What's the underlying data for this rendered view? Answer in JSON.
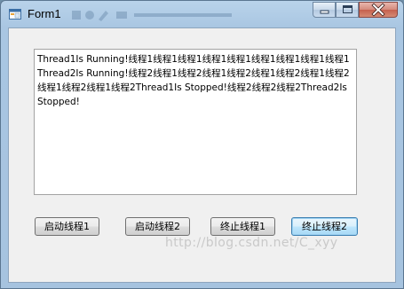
{
  "window": {
    "title": "Form1",
    "watermark": "http://blog.csdn.net/C_xyy"
  },
  "output": {
    "text": "Thread1Is Running!线程1线程1线程1线程1线程1线程1线程1线程1线程1Thread2Is Running!线程2线程1线程2线程1线程2线程1线程2线程1线程2线程1线程2线程1线程2Thread1Is Stopped!线程2线程2线程2Thread2Is Stopped!"
  },
  "buttons": {
    "start_thread1": "启动线程1",
    "start_thread2": "启动线程2",
    "stop_thread1": "终止线程1",
    "stop_thread2": "终止线程2"
  },
  "icons": {
    "app": "form-app-icon",
    "minimize": "minimize-icon",
    "maximize": "maximize-icon",
    "close": "close-icon"
  },
  "colors": {
    "title_bar": "#b9d3ea",
    "client_bg": "#f0f0f0",
    "close_button": "#c5604e",
    "focused_button_border": "#3c7fb1"
  }
}
